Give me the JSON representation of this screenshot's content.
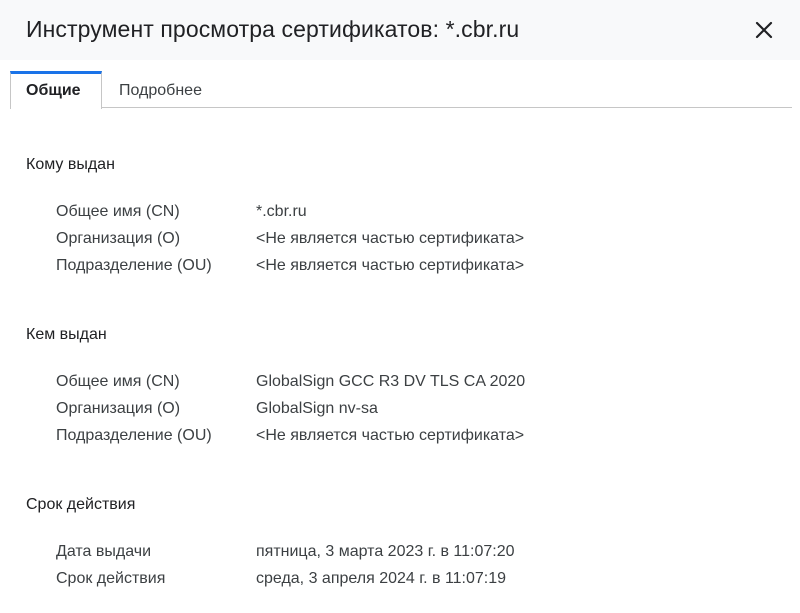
{
  "window": {
    "title": "Инструмент просмотра сертификатов: *.cbr.ru",
    "close_icon": "close-icon"
  },
  "tabs": [
    {
      "label": "Общие",
      "active": true
    },
    {
      "label": "Подробнее",
      "active": false
    }
  ],
  "sections": {
    "issued_to": {
      "heading": "Кому выдан",
      "rows": [
        {
          "label": "Общее имя (CN)",
          "value": "*.cbr.ru"
        },
        {
          "label": "Организация (O)",
          "value": "<Не является частью сертификата>"
        },
        {
          "label": "Подразделение (OU)",
          "value": "<Не является частью сертификата>"
        }
      ]
    },
    "issued_by": {
      "heading": "Кем выдан",
      "rows": [
        {
          "label": "Общее имя (CN)",
          "value": "GlobalSign GCC R3 DV TLS CA 2020"
        },
        {
          "label": "Организация (O)",
          "value": "GlobalSign nv-sa"
        },
        {
          "label": "Подразделение (OU)",
          "value": "<Не является частью сертификата>"
        }
      ]
    },
    "validity": {
      "heading": "Срок действия",
      "rows": [
        {
          "label": "Дата выдачи",
          "value": "пятница, 3 марта 2023 г. в 11:07:20"
        },
        {
          "label": "Срок действия",
          "value": "среда, 3 апреля 2024 г. в 11:07:19"
        }
      ]
    }
  },
  "colors": {
    "accent": "#1a73e8",
    "title_bar_bg": "#f8f9fa"
  }
}
